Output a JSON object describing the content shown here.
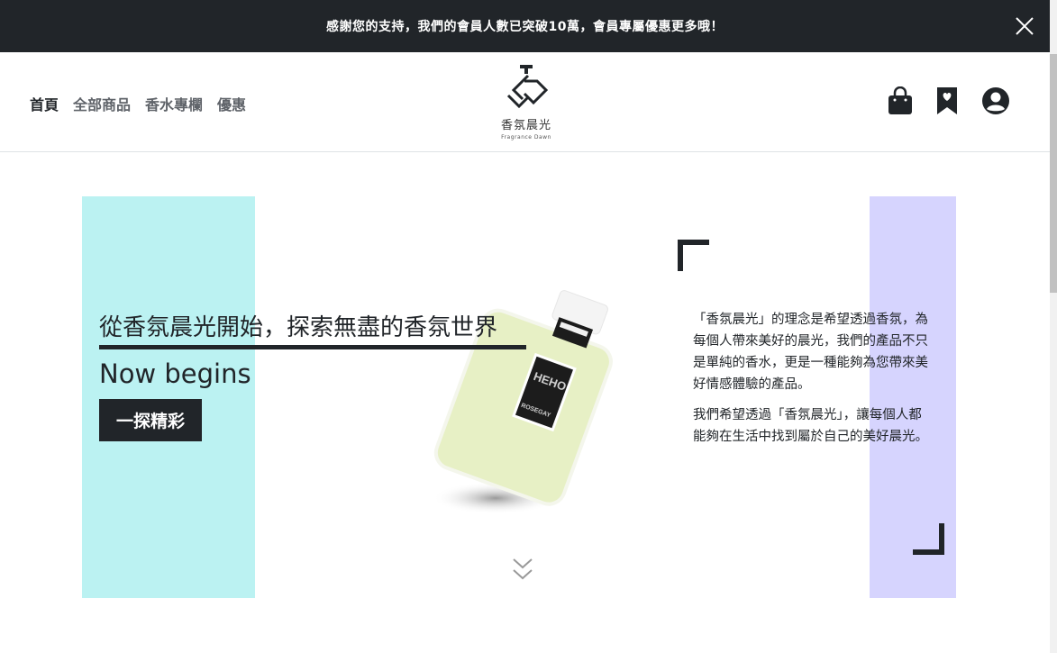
{
  "announcement": {
    "text": "感謝您的支持，我們的會員人數已突破10萬，會員專屬優惠更多哦！",
    "close_icon": "close-icon"
  },
  "header": {
    "nav": [
      {
        "label": "首頁",
        "active": true
      },
      {
        "label": "全部商品",
        "active": false
      },
      {
        "label": "香水專欄",
        "active": false
      },
      {
        "label": "優惠",
        "active": false
      }
    ],
    "logo": {
      "name": "香氛晨光",
      "subtitle": "Fragrance Dawn"
    },
    "icons": [
      "shopping-bag-icon",
      "bookmark-heart-icon",
      "account-icon"
    ]
  },
  "hero": {
    "title": "從香氛晨光開始，探索無盡的香氛世界",
    "subtitle": "Now begins",
    "button_label": "一探精彩",
    "bottle_label_line1": "HEHO",
    "bottle_label_line2": "ROSEGAY",
    "paragraphs": [
      "「香氛晨光」的理念是希望透過香氛，為每個人帶來美好的晨光，我們的產品不只是單純的香水，更是一種能夠為您帶來美好情感體驗的產品。",
      "我們希望透過「香氛晨光」，讓每個人都能夠在生活中找到屬於自己的美好晨光。"
    ],
    "colors": {
      "left_panel": "#bbf2f2",
      "right_panel": "#d6d4fe",
      "dark": "#212529"
    }
  }
}
